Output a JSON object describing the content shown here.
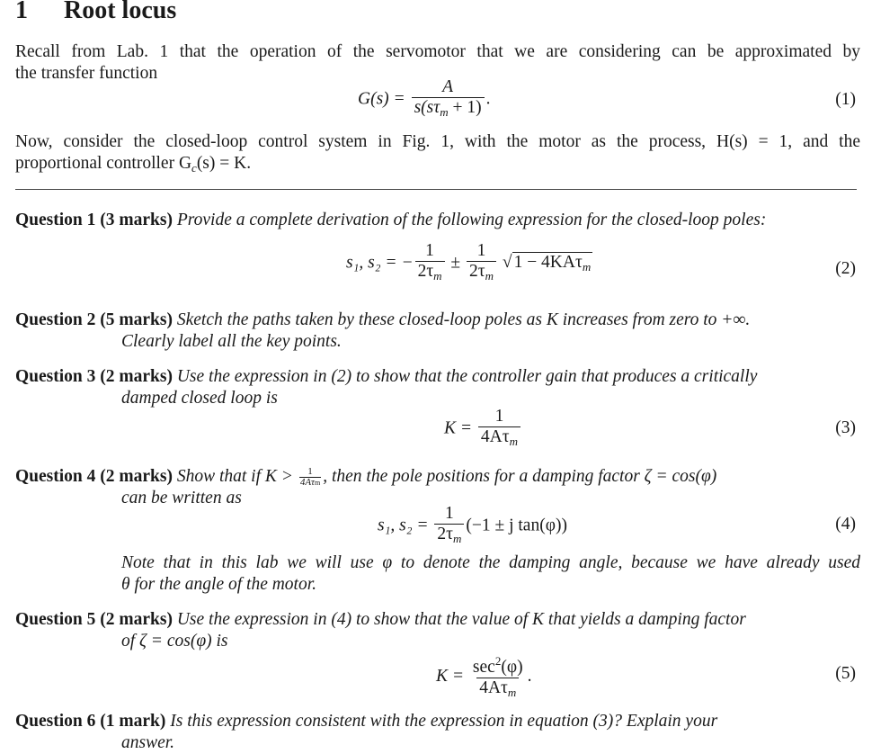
{
  "section": {
    "number": "1",
    "title": "Root locus"
  },
  "intro": {
    "para1_line1": "Recall from Lab. 1 that the operation of the servomotor that we are considering can be approximated by",
    "para1_line2": "the transfer function",
    "eq1": {
      "lhs": "G(s) =",
      "numerator": "A",
      "denominator": "s(sτ",
      "den_sub": "m",
      "den_tail": " + 1)",
      "trailing": ".",
      "number": "(1)"
    },
    "para2_line1": "Now, consider the closed-loop control system in Fig. 1, with the motor as the process, H(s) = 1, and the",
    "para2_line2": "proportional controller G",
    "para2_sub": "c",
    "para2_tail": "(s) = K."
  },
  "questions": [
    {
      "label": "Question 1",
      "marks": "(3 marks)",
      "text_line1": "Provide a complete derivation of the following expression for the closed-loop poles:",
      "equation": {
        "lhs": "s₁, s₂ = −",
        "frac1_num": "1",
        "frac1_den": "2τ",
        "pm": "±",
        "frac2_num": "1",
        "frac2_den": "2τ",
        "sqrt_body": "1 − 4KAτ",
        "sub": "m",
        "number": "(2)"
      }
    },
    {
      "label": "Question 2",
      "marks": "(5 marks)",
      "text_line1": "Sketch the paths taken by these closed-loop poles as K increases from zero to +∞.",
      "text_line2": "Clearly label all the key points."
    },
    {
      "label": "Question 3",
      "marks": "(2 marks)",
      "text_line1": "Use the expression in (2) to show that the controller gain that produces a critically",
      "text_line2": "damped closed loop is",
      "equation": {
        "lhs": "K =",
        "num": "1",
        "den": "4Aτ",
        "sub": "m",
        "number": "(3)"
      }
    },
    {
      "label": "Question 4",
      "marks": "(2 marks)",
      "text_pre": "Show that if K >",
      "inline_frac_num": "1",
      "inline_frac_den": "4Aτ",
      "inline_frac_sub": "m",
      "text_post": ", then the pole positions for a damping factor ζ = cos(φ)",
      "text_line2": "can be written as",
      "equation": {
        "lhs": "s₁, s₂ =",
        "num": "1",
        "den": "2τ",
        "sub": "m",
        "tail": "(−1 ± j tan(φ))",
        "number": "(4)"
      },
      "note_line1": "Note that in this lab we will use φ to denote the damping angle, because we have already used",
      "note_line2": "θ for the angle of the motor."
    },
    {
      "label": "Question 5",
      "marks": "(2 marks)",
      "text_line1": "Use the expression in (4) to show that the value of K that yields a damping factor",
      "text_line2": "of ζ = cos(φ) is",
      "equation": {
        "lhs": "K =",
        "num": "sec",
        "num_sup": "2",
        "num_tail": "(φ)",
        "den": "4Aτ",
        "sub": "m",
        "trailing": ".",
        "number": "(5)"
      }
    },
    {
      "label": "Question 6",
      "marks": "(1 mark)",
      "text_line1": "Is this expression consistent with the expression in equation (3)? Explain your",
      "text_line2": "answer."
    }
  ]
}
